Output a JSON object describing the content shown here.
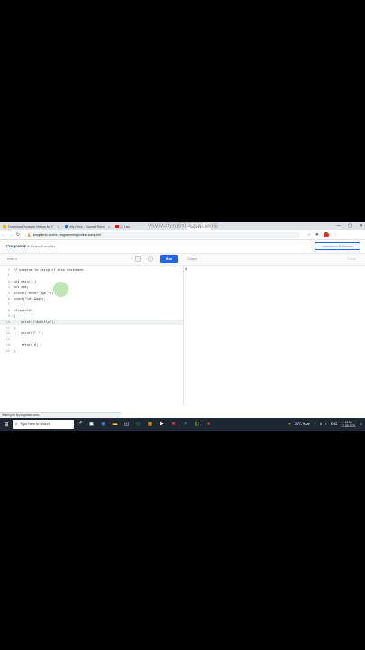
{
  "tabs": [
    {
      "label": "Download Youtube Videos for F",
      "fav_color": "#f4b400"
    },
    {
      "label": "My Drive - Google Drive",
      "fav_color": "#1a73e8"
    },
    {
      "label": "C Lan",
      "fav_color": "#ff0000"
    },
    {
      "label": "Compiler",
      "fav_color": "#2563eb"
    }
  ],
  "new_tab": "+",
  "window_controls": [
    "—",
    "▢",
    "✕"
  ],
  "url": "programiz.com/c-programming/online-compiler/",
  "site": {
    "logo_p": "P",
    "logo_rest": "rogramiz",
    "title": "C Online Compiler",
    "course_button": "Interactive C Course"
  },
  "toolbar": {
    "filename": "main.c",
    "run": "Run",
    "output": "Output",
    "clear": "Clear"
  },
  "code_lines": [
    {
      "n": "1",
      "fold": "",
      "text": "// program to using if else statement"
    },
    {
      "n": "2",
      "fold": "",
      "text": ""
    },
    {
      "n": "3",
      "fold": "▾",
      "text": "int main() {"
    },
    {
      "n": "4",
      "fold": "",
      "text": "int age;"
    },
    {
      "n": "5",
      "fold": "",
      "text": "printf(\"enter age \");"
    },
    {
      "n": "6",
      "fold": "",
      "text": "scanf(\"%d\",&age);"
    },
    {
      "n": "7",
      "fold": "",
      "text": ""
    },
    {
      "n": "8",
      "fold": "",
      "text": "if(age>18)"
    },
    {
      "n": "9",
      "fold": "▾",
      "text": "{"
    },
    {
      "n": "10",
      "fold": "",
      "text": "    printf(\"Adult\\n\");"
    },
    {
      "n": "11",
      "fold": "",
      "text": "}"
    },
    {
      "n": "12",
      "fold": "",
      "text": "    printf(\" \");"
    },
    {
      "n": "13",
      "fold": "",
      "text": ""
    },
    {
      "n": "14",
      "fold": "",
      "text": "    return 0;"
    },
    {
      "n": "15",
      "fold": "",
      "text": "}"
    }
  ],
  "output_text": "$",
  "status": "Waiting for tp.programiz.com...",
  "taskbar": {
    "search_placeholder": "Type here to search",
    "weather": "26°C  Haze",
    "lang": "ENG",
    "time": "14:59",
    "date": "31-08-2021"
  },
  "watermark": "www.BANDICAM.com"
}
